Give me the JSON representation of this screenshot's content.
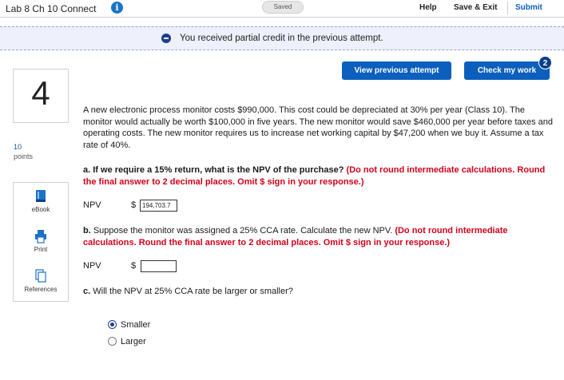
{
  "header": {
    "title": "Lab 8 Ch 10 Connect",
    "saved": "Saved",
    "help": "Help",
    "save_exit": "Save & Exit",
    "submit": "Submit"
  },
  "banner": {
    "message": "You received partial credit in the previous attempt."
  },
  "actions": {
    "view_previous": "View previous attempt",
    "check_work": "Check my work",
    "check_badge": "2"
  },
  "question": {
    "number": "4",
    "points_value": "10",
    "points_label": "points",
    "text": "A new electronic process monitor costs $990,000. This cost could be depreciated at 30% per year (Class 10). The monitor would actually be worth $100,000 in five years. The new monitor would save $460,000 per year before taxes and operating costs. The new monitor requires us to increase net working capital by $47,200 when we buy it. Assume a tax rate of 40%.",
    "part_a_label": "a.",
    "part_a_text": "If we require a 15% return, what is the NPV of the purchase?",
    "part_a_note": "(Do not round intermediate calculations. Round the final answer to 2 decimal places. Omit $ sign in your response.)",
    "part_b_label": "b.",
    "part_b_text": "Suppose the monitor was assigned a 25% CCA rate. Calculate the new NPV.",
    "part_b_note": "(Do not round intermediate calculations. Round the final answer to 2 decimal places. Omit $ sign in your response.)",
    "part_c_label": "c.",
    "part_c_text": "Will the NPV at 25% CCA rate be larger or smaller?",
    "npv_label": "NPV",
    "dollar": "$",
    "answer_a": "194,703.7",
    "answer_b": "",
    "options": [
      "Smaller",
      "Larger"
    ],
    "selected_option": "Smaller"
  },
  "tools": {
    "ebook": "eBook",
    "print": "Print",
    "references": "References"
  },
  "colors": {
    "primary": "#0b5fbd",
    "alert": "#d0021b",
    "banner_bg": "#eef1fb"
  }
}
